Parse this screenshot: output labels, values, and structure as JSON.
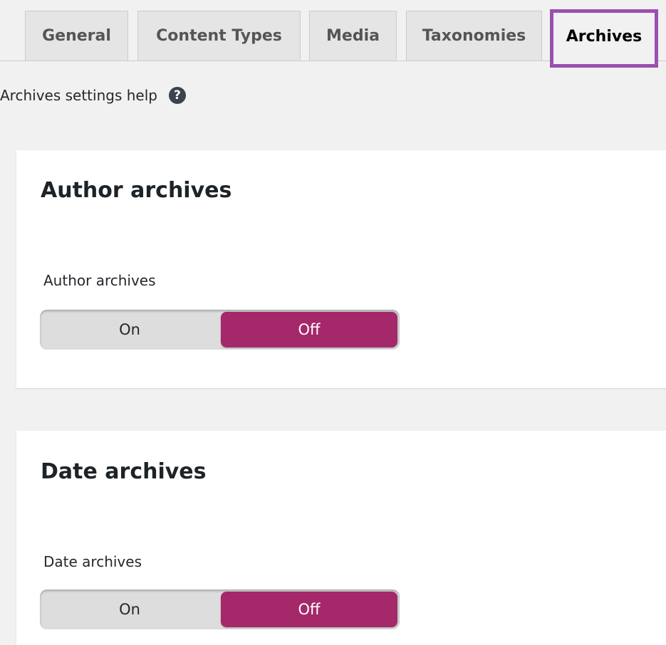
{
  "tabs": [
    {
      "label": "General"
    },
    {
      "label": "Content Types"
    },
    {
      "label": "Media"
    },
    {
      "label": "Taxonomies"
    },
    {
      "label": "Archives"
    }
  ],
  "active_tab": "Archives",
  "help": {
    "label": "Archives settings help",
    "icon": "question-circle-icon",
    "icon_glyph": "?"
  },
  "sections": {
    "author": {
      "title": "Author archives",
      "field_label": "Author archives",
      "on_label": "On",
      "off_label": "Off",
      "selected": "Off"
    },
    "date": {
      "title": "Date archives",
      "field_label": "Date archives",
      "on_label": "On",
      "off_label": "Off",
      "selected": "Off"
    }
  },
  "colors": {
    "accent": "#a4286a",
    "highlight": "#9b4fb0",
    "background": "#f1f1f1"
  }
}
